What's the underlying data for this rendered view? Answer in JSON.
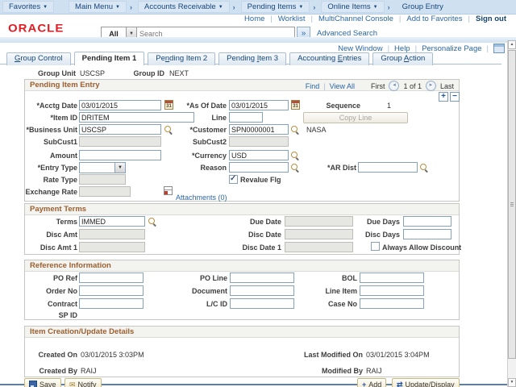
{
  "colors": {
    "oracle_red": "#e21a22",
    "crumb_bg": "#cfe0f1",
    "section_title": "#9c5f2f",
    "link_blue": "#2a66a5"
  },
  "icons": {
    "dropdown_arrow": "▼",
    "separator": "›",
    "go": "»",
    "pipe": "|",
    "plus": "+",
    "minus": "−",
    "prev": "◄",
    "next": "►",
    "up": "▲",
    "down": "▼",
    "check": "✓",
    "calendar": "31",
    "envelope": "✉",
    "swap": "⇄",
    "add_plus": "+"
  },
  "breadcrumb": {
    "items": [
      {
        "label": "Favorites",
        "menu": true
      },
      {
        "label": "Main Menu",
        "menu": true
      },
      {
        "label": "Accounts Receivable",
        "menu": true
      },
      {
        "label": "Pending Items",
        "menu": true
      },
      {
        "label": "Online Items",
        "menu": true
      },
      {
        "label": "Group Entry",
        "menu": false
      }
    ]
  },
  "header": {
    "logo": "ORACLE",
    "links": [
      "Home",
      "Worklist",
      "MultiChannel Console",
      "Add to Favorites"
    ],
    "signout": "Sign out",
    "search": {
      "scope": "All",
      "placeholder": "Search",
      "advanced": "Advanced Search"
    },
    "page_links": [
      "New Window",
      "Help",
      "Personalize Page"
    ]
  },
  "tabs": [
    {
      "pre": "",
      "key": "G",
      "post": "roup Control",
      "active": false
    },
    {
      "pre": "Pending Item 1",
      "key": "",
      "post": "",
      "active": true
    },
    {
      "pre": "Pe",
      "key": "n",
      "post": "ding Item 2",
      "active": false
    },
    {
      "pre": "Pending ",
      "key": "I",
      "post": "tem 3",
      "active": false
    },
    {
      "pre": "Accounting ",
      "key": "E",
      "post": "ntries",
      "active": false
    },
    {
      "pre": "Group ",
      "key": "A",
      "post": "ction",
      "active": false
    }
  ],
  "group": {
    "unit_label": "Group Unit",
    "unit_value": "USCSP",
    "id_label": "Group ID",
    "id_value": "NEXT"
  },
  "pending": {
    "title": "Pending Item Entry",
    "nav": {
      "find": "Find",
      "view_all": "View All",
      "first": "First",
      "position": "1 of 1",
      "last": "Last"
    },
    "fields": {
      "acctg_date": {
        "label": "*Acctg Date",
        "value": "03/01/2015"
      },
      "as_of_date": {
        "label": "*As Of Date",
        "value": "03/01/2015"
      },
      "sequence": {
        "label": "Sequence",
        "value": "1"
      },
      "item_id": {
        "label": "*Item ID",
        "value": "DRITEM"
      },
      "line": {
        "label": "Line",
        "value": ""
      },
      "copy_line": {
        "label": "Copy Line"
      },
      "business_unit": {
        "label": "*Business Unit",
        "value": "USCSP"
      },
      "customer": {
        "label": "*Customer",
        "value": "SPN0000001",
        "description": "NASA"
      },
      "subcust1": {
        "label": "SubCust1",
        "value": ""
      },
      "subcust2": {
        "label": "SubCust2",
        "value": ""
      },
      "amount": {
        "label": "Amount",
        "value": ""
      },
      "currency": {
        "label": "*Currency",
        "value": "USD"
      },
      "entry_type": {
        "label": "*Entry Type",
        "value": ""
      },
      "reason": {
        "label": "Reason",
        "value": ""
      },
      "ar_dist": {
        "label": "*AR Dist",
        "value": ""
      },
      "rate_type": {
        "label": "Rate Type",
        "value": ""
      },
      "revalue_flg": {
        "label": "Revalue Flg",
        "checked": true
      },
      "exchange_rate": {
        "label": "Exchange Rate",
        "value": ""
      },
      "attachments": {
        "label": "Attachments (0)"
      }
    }
  },
  "payment": {
    "title": "Payment Terms",
    "fields": {
      "terms": {
        "label": "Terms",
        "value": "IMMED"
      },
      "due_date": {
        "label": "Due Date",
        "value": ""
      },
      "due_days": {
        "label": "Due Days",
        "value": ""
      },
      "disc_amt": {
        "label": "Disc Amt",
        "value": ""
      },
      "disc_date": {
        "label": "Disc Date",
        "value": ""
      },
      "disc_days": {
        "label": "Disc Days",
        "value": ""
      },
      "disc_amt1": {
        "label": "Disc Amt 1",
        "value": ""
      },
      "disc_date1": {
        "label": "Disc Date 1",
        "value": ""
      },
      "always_allow": {
        "label": "Always Allow Discount",
        "checked": false
      }
    }
  },
  "reference": {
    "title": "Reference Information",
    "fields": {
      "po_ref": {
        "label": "PO Ref",
        "value": ""
      },
      "po_line": {
        "label": "PO Line",
        "value": ""
      },
      "bol": {
        "label": "BOL",
        "value": ""
      },
      "order_no": {
        "label": "Order No",
        "value": ""
      },
      "document": {
        "label": "Document",
        "value": ""
      },
      "line_item": {
        "label": "Line Item",
        "value": ""
      },
      "contract": {
        "label": "Contract",
        "value": ""
      },
      "lc_id": {
        "label": "L/C ID",
        "value": ""
      },
      "case_no": {
        "label": "Case No",
        "value": ""
      },
      "sp_id": {
        "label": "SP ID"
      }
    }
  },
  "details": {
    "title": "Item Creation/Update Details",
    "created_on": {
      "label": "Created On",
      "value": "03/01/2015  3:03PM"
    },
    "last_modified_on": {
      "label": "Last Modified On",
      "value": "03/01/2015  3:04PM"
    },
    "created_by": {
      "label": "Created By",
      "value": "RAIJ"
    },
    "modified_by": {
      "label": "Modified By",
      "value": "RAIJ"
    }
  },
  "toolbar": {
    "save": "Save",
    "notify": "Notify",
    "add": "Add",
    "update": "Update/Display"
  }
}
